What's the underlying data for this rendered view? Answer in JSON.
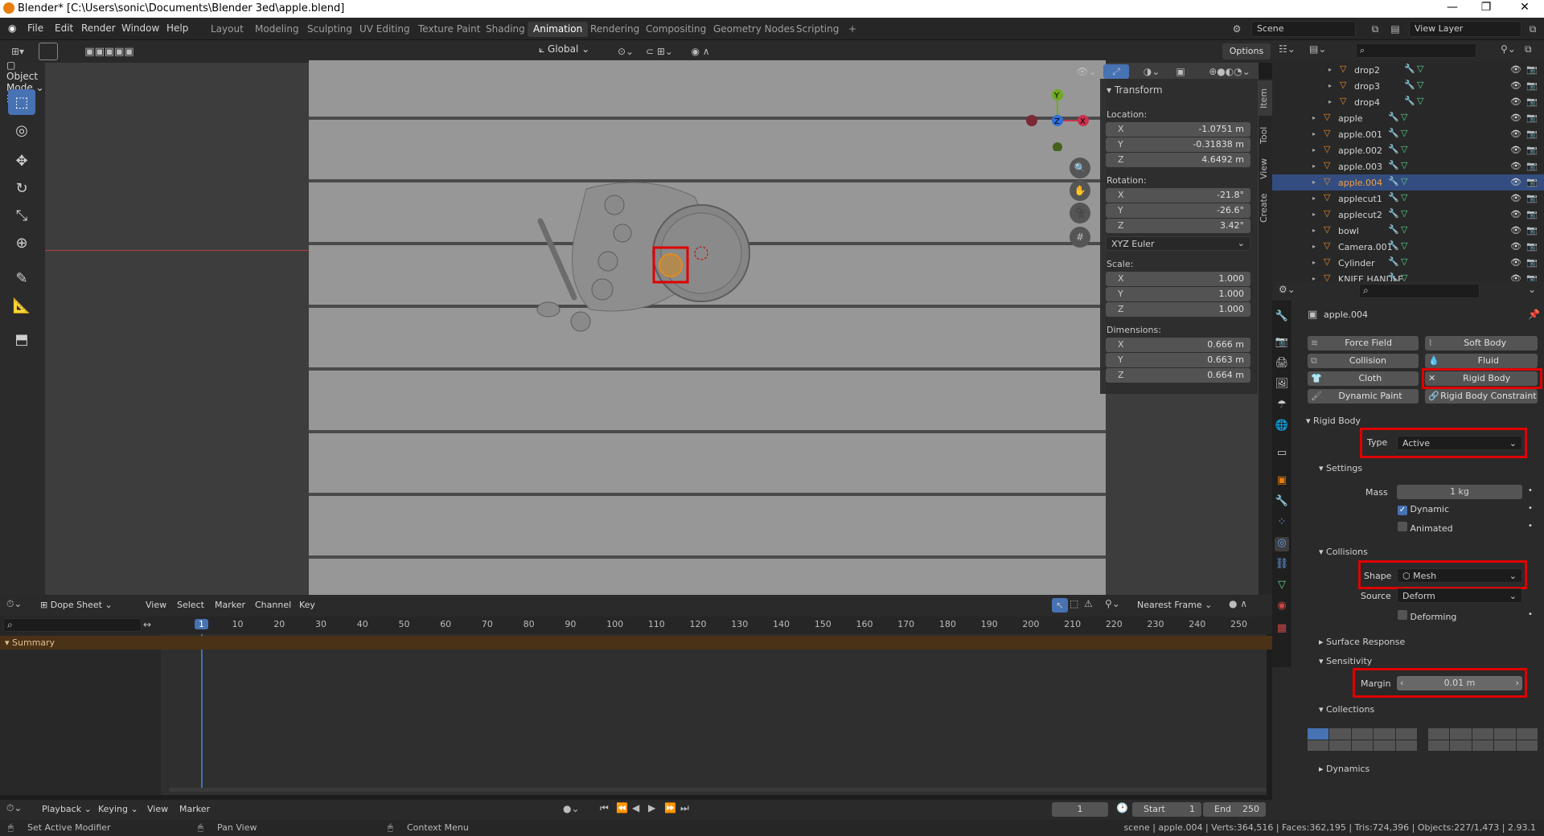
{
  "titlebar": {
    "title": "Blender* [C:\\Users\\sonic\\Documents\\Blender 3ed\\apple.blend]"
  },
  "menu": [
    "File",
    "Edit",
    "Render",
    "Window",
    "Help"
  ],
  "workspaces": [
    "Layout",
    "Modeling",
    "Sculpting",
    "UV Editing",
    "Texture Paint",
    "Shading",
    "Animation",
    "Rendering",
    "Compositing",
    "Geometry Nodes",
    "Scripting"
  ],
  "active_workspace": "Animation",
  "scene": {
    "label": "Scene",
    "view_layer": "View Layer"
  },
  "viewport": {
    "mode": "Object Mode",
    "orientation": "Global",
    "options": "Options"
  },
  "npanel": {
    "title": "Transform",
    "location_label": "Location:",
    "location": {
      "x": "-1.0751 m",
      "y": "-0.31838 m",
      "z": "4.6492 m"
    },
    "rotation_label": "Rotation:",
    "rotation": {
      "x": "-21.8°",
      "y": "-26.6°",
      "z": "3.42°"
    },
    "rotation_mode": "XYZ Euler",
    "scale_label": "Scale:",
    "scale": {
      "x": "1.000",
      "y": "1.000",
      "z": "1.000"
    },
    "dimensions_label": "Dimensions:",
    "dimensions": {
      "x": "0.666 m",
      "y": "0.663 m",
      "z": "0.664 m"
    },
    "tabs": [
      "Item",
      "Tool",
      "View",
      "Create"
    ]
  },
  "axis": {
    "x": "X",
    "y": "Y",
    "z": "Z"
  },
  "outliner": {
    "rows": [
      {
        "name": "drop2",
        "indent": 2,
        "expand": true
      },
      {
        "name": "drop3",
        "indent": 2,
        "expand": true
      },
      {
        "name": "drop4",
        "indent": 2,
        "expand": true
      },
      {
        "name": "apple",
        "indent": 1,
        "expand": true
      },
      {
        "name": "apple.001",
        "indent": 1,
        "expand": true
      },
      {
        "name": "apple.002",
        "indent": 1,
        "expand": true
      },
      {
        "name": "apple.003",
        "indent": 1,
        "expand": true
      },
      {
        "name": "apple.004",
        "indent": 1,
        "expand": true,
        "selected": true
      },
      {
        "name": "applecut1",
        "indent": 1,
        "expand": true
      },
      {
        "name": "applecut2",
        "indent": 1,
        "expand": true
      },
      {
        "name": "bowl",
        "indent": 1,
        "expand": true
      },
      {
        "name": "Camera.001",
        "indent": 1,
        "expand": true
      },
      {
        "name": "Cylinder",
        "indent": 1,
        "expand": true
      },
      {
        "name": "KNIFE HANDLE",
        "indent": 1,
        "expand": true
      }
    ]
  },
  "properties": {
    "object_name": "apple.004",
    "physics_buttons": [
      "Force Field",
      "Soft Body",
      "Collision",
      "Fluid",
      "Cloth",
      "Rigid Body",
      "Dynamic Paint",
      "Rigid Body Constraint"
    ],
    "rigid_body": {
      "section": "Rigid Body",
      "type_label": "Type",
      "type_value": "Active",
      "settings_label": "Settings",
      "mass_label": "Mass",
      "mass_value": "1 kg",
      "dynamic_label": "Dynamic",
      "animated_label": "Animated",
      "collisions_label": "Collisions",
      "shape_label": "Shape",
      "shape_value": "Mesh",
      "source_label": "Source",
      "source_value": "Deform",
      "deforming_label": "Deforming",
      "surface_response_label": "Surface Response",
      "sensitivity_label": "Sensitivity",
      "margin_label": "Margin",
      "margin_value": "0.01 m",
      "collections_label": "Collections",
      "dynamics_label": "Dynamics"
    }
  },
  "dopesheet": {
    "editor": "Dope Sheet",
    "menus": [
      "View",
      "Select",
      "Marker",
      "Channel",
      "Key"
    ],
    "snap": "Nearest Frame",
    "ruler": [
      "1",
      "10",
      "20",
      "30",
      "40",
      "50",
      "60",
      "70",
      "80",
      "90",
      "100",
      "110",
      "120",
      "130",
      "140",
      "150",
      "160",
      "170",
      "180",
      "190",
      "200",
      "210",
      "220",
      "230",
      "240",
      "250"
    ],
    "summary": "Summary"
  },
  "timeline": {
    "menus": [
      "Playback",
      "Keying",
      "View",
      "Marker"
    ],
    "current_frame": "1",
    "start_label": "Start",
    "start": "1",
    "end_label": "End",
    "end": "250"
  },
  "statusbar": {
    "left1": "Set Active Modifier",
    "left2": "Pan View",
    "left3": "Context Menu",
    "right": "scene | apple.004 | Verts:364,516 | Faces:362,195 | Tris:724,396 | Objects:227/1,473 | 2.93.1"
  },
  "colors": {
    "accent": "#4772b3",
    "highlight": "#e00000",
    "selected_row": "#334d80"
  }
}
